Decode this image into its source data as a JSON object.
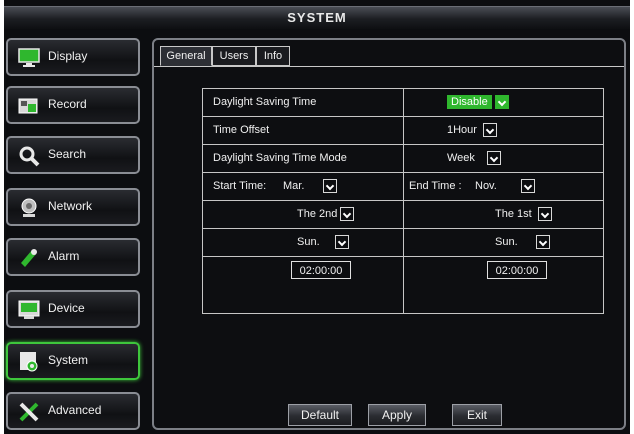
{
  "window": {
    "title": "SYSTEM"
  },
  "sidebar": {
    "items": [
      {
        "label": "Display",
        "icon": "display-icon",
        "active": false
      },
      {
        "label": "Record",
        "icon": "record-icon",
        "active": false
      },
      {
        "label": "Search",
        "icon": "search-icon",
        "active": false
      },
      {
        "label": "Network",
        "icon": "network-icon",
        "active": false
      },
      {
        "label": "Alarm",
        "icon": "alarm-icon",
        "active": false
      },
      {
        "label": "Device",
        "icon": "device-icon",
        "active": false
      },
      {
        "label": "System",
        "icon": "system-icon",
        "active": true
      },
      {
        "label": "Advanced",
        "icon": "advanced-icon",
        "active": false
      }
    ]
  },
  "tabs": [
    {
      "label": "General",
      "active": true
    },
    {
      "label": "Users",
      "active": false
    },
    {
      "label": "Info",
      "active": false
    }
  ],
  "settings": {
    "dst_label": "Daylight Saving Time",
    "dst_value": "Disable",
    "offset_label": "Time Offset",
    "offset_value": "1Hour",
    "mode_label": "Daylight Saving Time Mode",
    "mode_value": "Week",
    "start_label": "Start Time:",
    "start_month": "Mar.",
    "end_label": "End Time :",
    "end_month": "Nov.",
    "start_week": "The 2nd",
    "end_week": "The 1st",
    "start_day": "Sun.",
    "end_day": "Sun.",
    "start_time": "02:00:00",
    "end_time": "02:00:00"
  },
  "buttons": {
    "default": "Default",
    "apply": "Apply",
    "exit": "Exit"
  },
  "colors": {
    "accent_green": "#2fb72e",
    "background": "#0c0d10"
  }
}
